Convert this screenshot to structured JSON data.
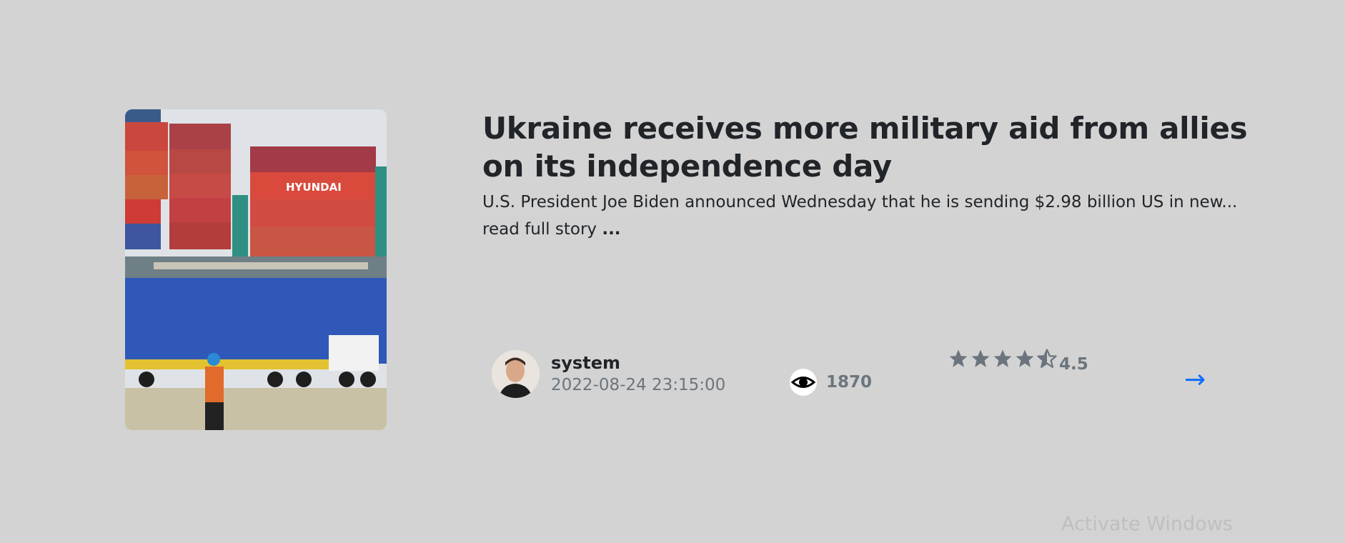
{
  "article": {
    "title": "Ukraine receives more military aid from allies on its independence day",
    "summary": "U.S. President Joe Biden announced Wednesday that he is sending $2.98 billion US in new...",
    "read_more_label": "read full story",
    "read_more_dots": "...",
    "image_alt": "shipping-containers-photo",
    "container_brand_text": "HYUNDAI"
  },
  "meta": {
    "author": "system",
    "date": "2022-08-24 23:15:00",
    "views": "1870",
    "rating_value": 4.5,
    "rating_label": "4.5",
    "rating_max": 5,
    "arrow_label": "→"
  },
  "system": {
    "watermark": "Activate Windows"
  },
  "colors": {
    "background": "#d3d3d3",
    "title": "#212529",
    "muted": "#6c757d",
    "accent": "#0d6efd"
  },
  "icons": {
    "views": "eye-icon",
    "star_full": "star-icon",
    "star_half": "star-half-icon",
    "arrow": "arrow-right-icon"
  }
}
